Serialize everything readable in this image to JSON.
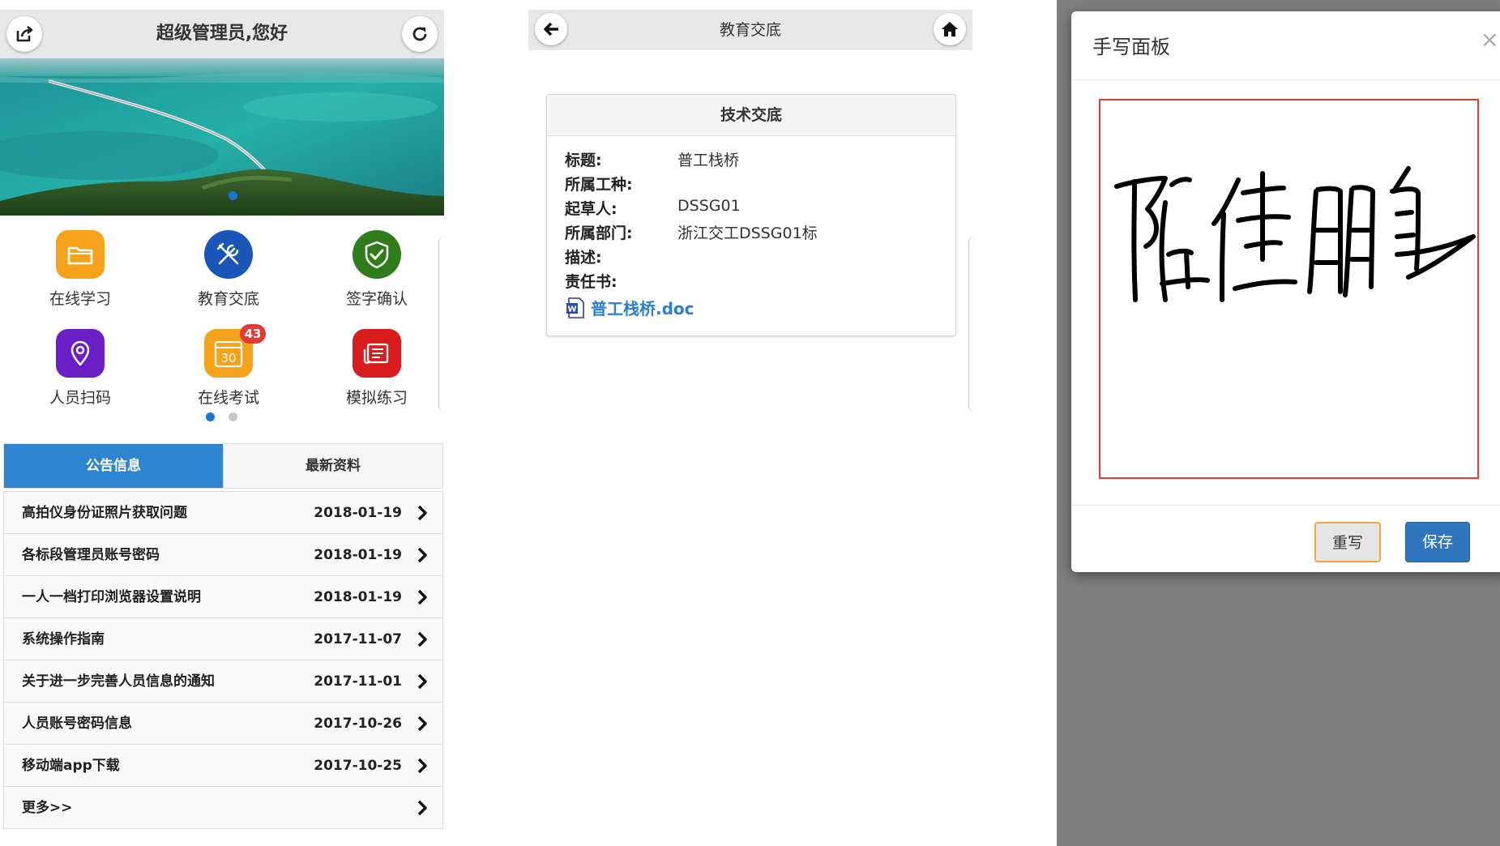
{
  "panel_home": {
    "header_title": "超级管理员,您好",
    "grid": [
      {
        "label": "在线学习",
        "icon": "folder-icon",
        "color": "#f6a21b"
      },
      {
        "label": "教育交底",
        "icon": "tools-icon",
        "color": "#1a55b8"
      },
      {
        "label": "签字确认",
        "icon": "shield-check-icon",
        "color": "#2e7d1a"
      },
      {
        "label": "人员扫码",
        "icon": "location-pin-icon",
        "color": "#6a1fc4"
      },
      {
        "label": "在线考试",
        "icon": "calendar-icon",
        "color": "#f6a21b",
        "badge": "43",
        "calendar_day": "30"
      },
      {
        "label": "模拟练习",
        "icon": "news-icon",
        "color": "#d91c1c"
      }
    ],
    "tabs": [
      {
        "label": "公告信息",
        "active": true
      },
      {
        "label": "最新资料",
        "active": false
      }
    ],
    "notices": [
      {
        "title": "高拍仪身份证照片获取问题",
        "date": "2018-01-19"
      },
      {
        "title": "各标段管理员账号密码",
        "date": "2018-01-19"
      },
      {
        "title": "一人一档打印浏览器设置说明",
        "date": "2018-01-19"
      },
      {
        "title": "系统操作指南",
        "date": "2017-11-07"
      },
      {
        "title": "关于进一步完善人员信息的通知",
        "date": "2017-11-01"
      },
      {
        "title": "人员账号密码信息",
        "date": "2017-10-26"
      },
      {
        "title": "移动端app下载",
        "date": "2017-10-25"
      },
      {
        "title": "更多>>",
        "date": ""
      }
    ],
    "accent_color": "#2f86d0"
  },
  "panel_detail": {
    "header_title": "教育交底",
    "card_title": "技术交底",
    "fields": [
      {
        "key": "标题:",
        "value": "普工栈桥"
      },
      {
        "key": "所属工种:",
        "value": ""
      },
      {
        "key": "起草人:",
        "value": "DSSG01"
      },
      {
        "key": "所属部门:",
        "value": "浙江交工DSSG01标"
      },
      {
        "key": "描述:",
        "value": ""
      },
      {
        "key": "责任书:",
        "value": ""
      }
    ],
    "attachment": "普工栈桥.doc"
  },
  "panel_sign": {
    "modal_title": "手写面板",
    "close_symbol": "×",
    "rewrite_label": "重写",
    "save_label": "保存"
  }
}
